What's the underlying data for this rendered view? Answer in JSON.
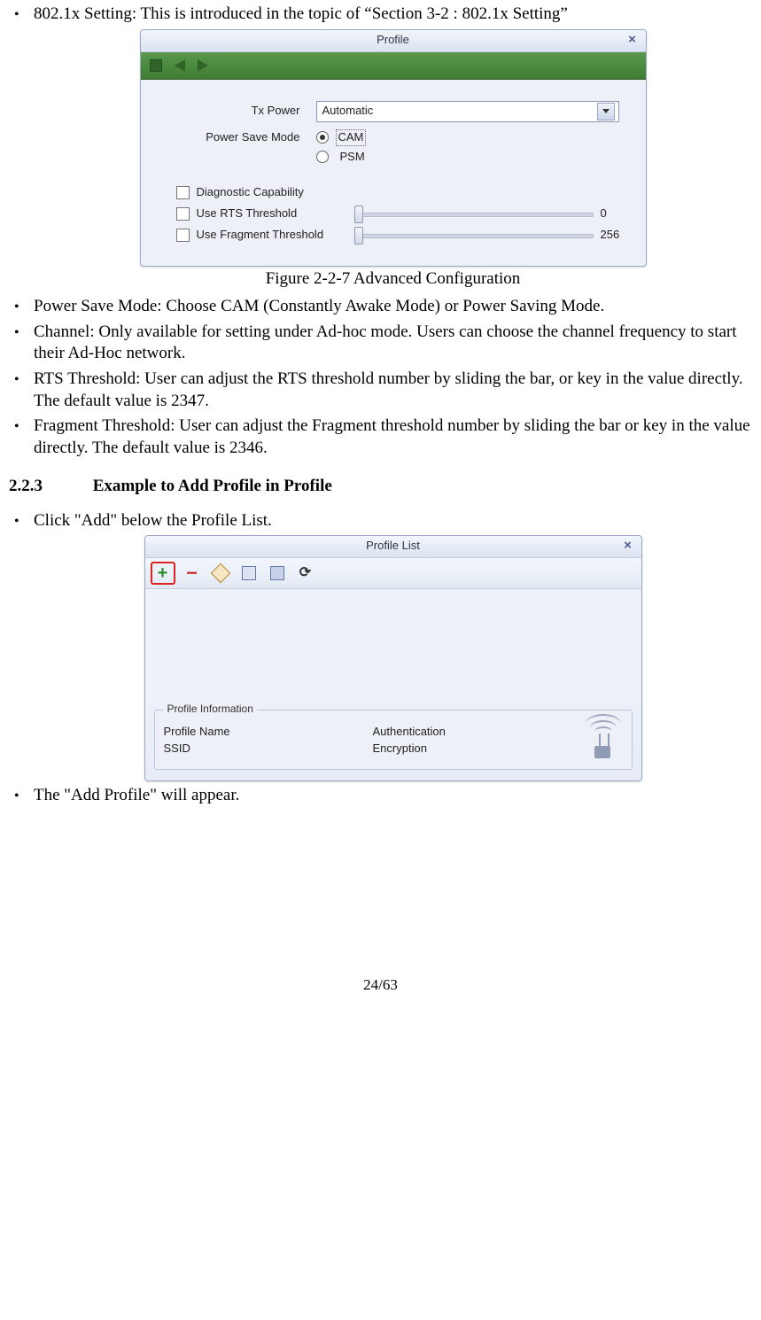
{
  "bullets_top": {
    "b0": "802.1x Setting: This is introduced in the topic of “Section 3-2 : 802.1x Setting”"
  },
  "figure1": {
    "title": "Profile",
    "tx_power_label": "Tx Power",
    "tx_power_value": "Automatic",
    "psm_label": "Power Save Mode",
    "radio_cam": "CAM",
    "radio_psm": "PSM",
    "chk_diag": "Diagnostic Capability",
    "chk_rts": "Use RTS Threshold",
    "chk_frag": "Use Fragment Threshold",
    "rts_value": "0",
    "frag_value": "256",
    "caption": "Figure 2-2-7 Advanced Configuration"
  },
  "bullets_mid": {
    "b1": "Power Save Mode: Choose CAM (Constantly Awake Mode) or Power Saving Mode.",
    "b2": "Channel: Only available for setting under Ad-hoc mode. Users can choose the channel frequency to start their Ad-Hoc network.",
    "b3": "RTS Threshold: User can adjust the RTS threshold number by sliding the bar, or key in the value directly. The default value is 2347.",
    "b4": "Fragment Threshold: User can adjust the Fragment threshold number by sliding the bar or key in the value directly. The default value is 2346."
  },
  "section": {
    "num": "2.2.3",
    "title": "Example to Add Profile in Profile"
  },
  "bullets_bottom": {
    "b5": "Click \"Add\" below the Profile List.",
    "b6": "The \"Add Profile\" will appear."
  },
  "figure2": {
    "title": "Profile List",
    "group_legend": "Profile Information",
    "pn_label": "Profile Name",
    "ssid_label": "SSID",
    "auth_label": "Authentication",
    "enc_label": "Encryption"
  },
  "page": "24/63"
}
